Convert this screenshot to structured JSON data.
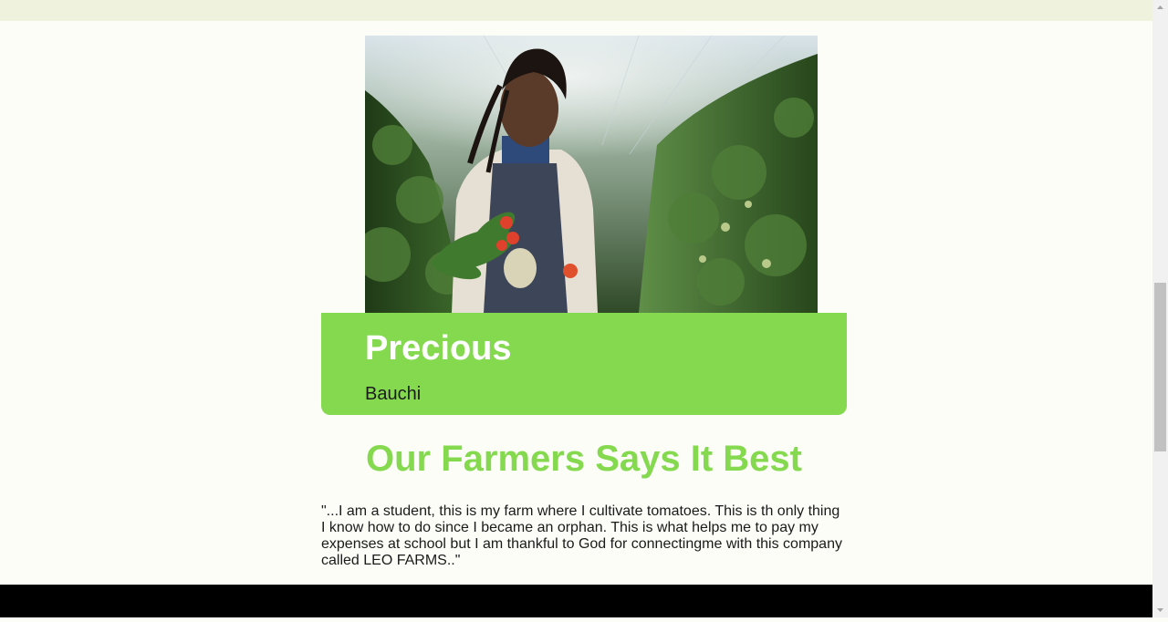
{
  "testimonial": {
    "name": "Precious",
    "location": "Bauchi",
    "photo_alt": "farmer-photo"
  },
  "section": {
    "title": "Our Farmers Says It Best"
  },
  "quote": {
    "text": "\"...I am a student, this is my farm where I cultivate tomatoes. This is th only thing I know how to do since I became an orphan. This is what helps me to pay my expenses at school but I am thankful to God for connectingme with this company called LEO FARMS..\""
  },
  "colors": {
    "accent_green": "#84d94e",
    "top_strip": "#eff3dd",
    "page_background": "#fdfdf8",
    "footer": "#000000"
  }
}
